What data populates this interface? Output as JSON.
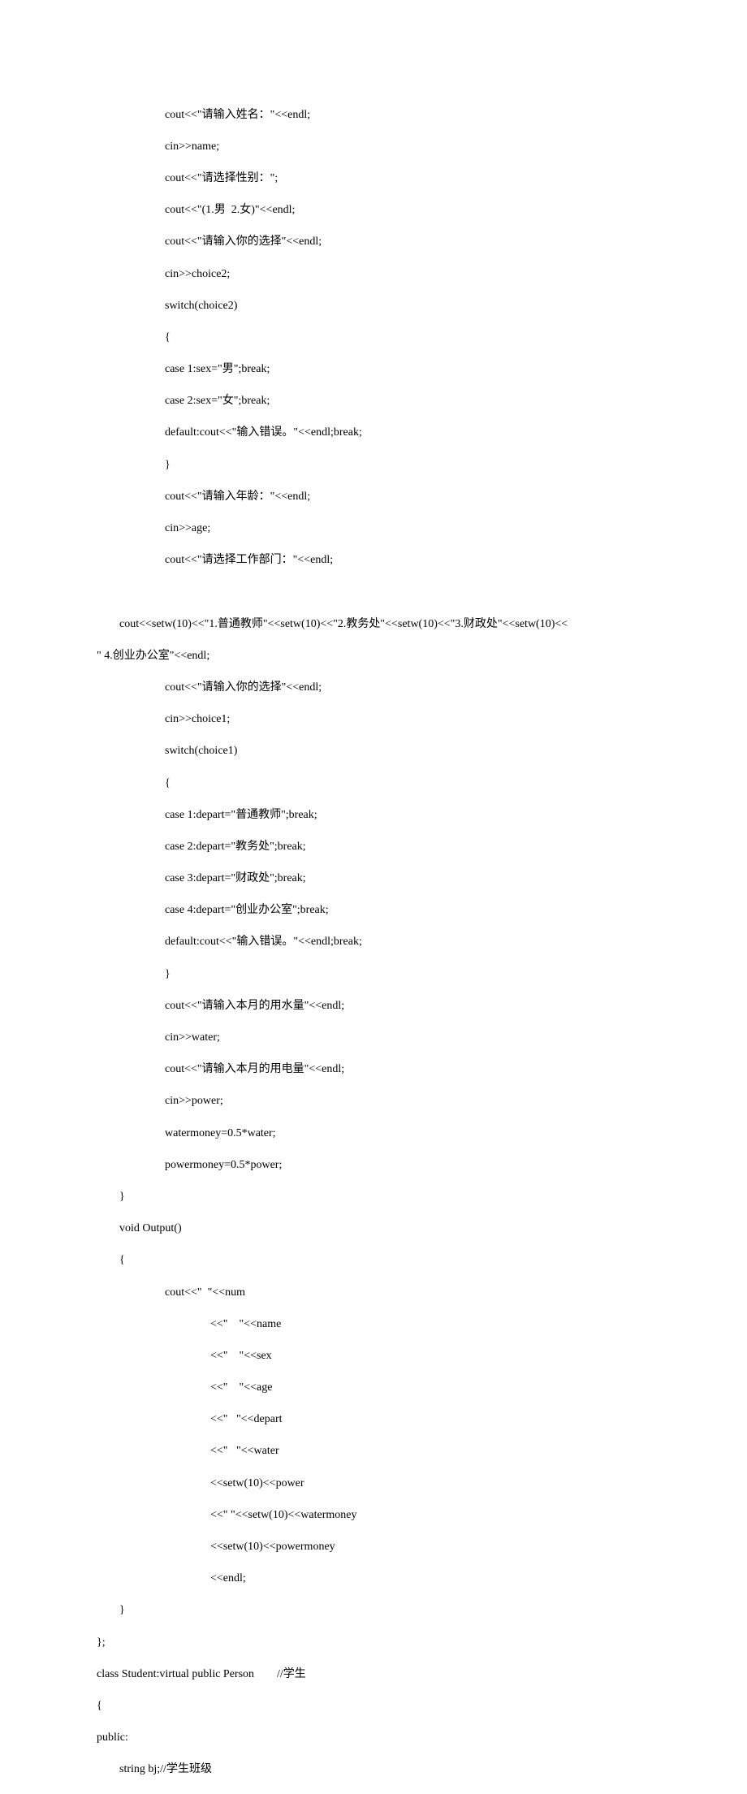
{
  "lines": [
    "                        cout<<\"请输入姓名：\"<<endl;",
    "                        cin>>name;",
    "                        cout<<\"请选择性别：\";",
    "                        cout<<\"(1.男  2.女)\"<<endl;",
    "                        cout<<\"请输入你的选择\"<<endl;",
    "                        cin>>choice2;",
    "                        switch(choice2)",
    "                        {",
    "                        case 1:sex=\"男\";break;",
    "                        case 2:sex=\"女\";break;",
    "                        default:cout<<\"输入错误。\"<<endl;break;",
    "                        }",
    "                        cout<<\"请输入年龄：\"<<endl;",
    "                        cin>>age;",
    "                        cout<<\"请选择工作部门：\"<<endl;",
    "        ",
    "        cout<<setw(10)<<\"1.普通教师\"<<setw(10)<<\"2.教务处\"<<setw(10)<<\"3.财政处\"<<setw(10)<<",
    "\" 4.创业办公室\"<<endl;",
    "                        cout<<\"请输入你的选择\"<<endl;",
    "                        cin>>choice1;",
    "                        switch(choice1)",
    "                        {",
    "                        case 1:depart=\"普通教师\";break;",
    "                        case 2:depart=\"教务处\";break;",
    "                        case 3:depart=\"财政处\";break;",
    "                        case 4:depart=\"创业办公室\";break;",
    "                        default:cout<<\"输入错误。\"<<endl;break;",
    "                        }",
    "                        cout<<\"请输入本月的用水量\"<<endl;",
    "                        cin>>water;",
    "                        cout<<\"请输入本月的用电量\"<<endl;",
    "                        cin>>power;",
    "                        watermoney=0.5*water;",
    "                        powermoney=0.5*power;",
    "        }",
    "        void Output()",
    "        {",
    "                        cout<<\"  \"<<num",
    "                                        <<\"    \"<<name",
    "                                        <<\"    \"<<sex",
    "                                        <<\"    \"<<age",
    "                                        <<\"   \"<<depart",
    "                                        <<\"   \"<<water",
    "                                        <<setw(10)<<power",
    "                                        <<\" \"<<setw(10)<<watermoney",
    "                                        <<setw(10)<<powermoney",
    "                                        <<endl;",
    "        }",
    "};",
    "class Student:virtual public Person        //学生",
    "{",
    "public:",
    "        string bj;//学生班级"
  ]
}
